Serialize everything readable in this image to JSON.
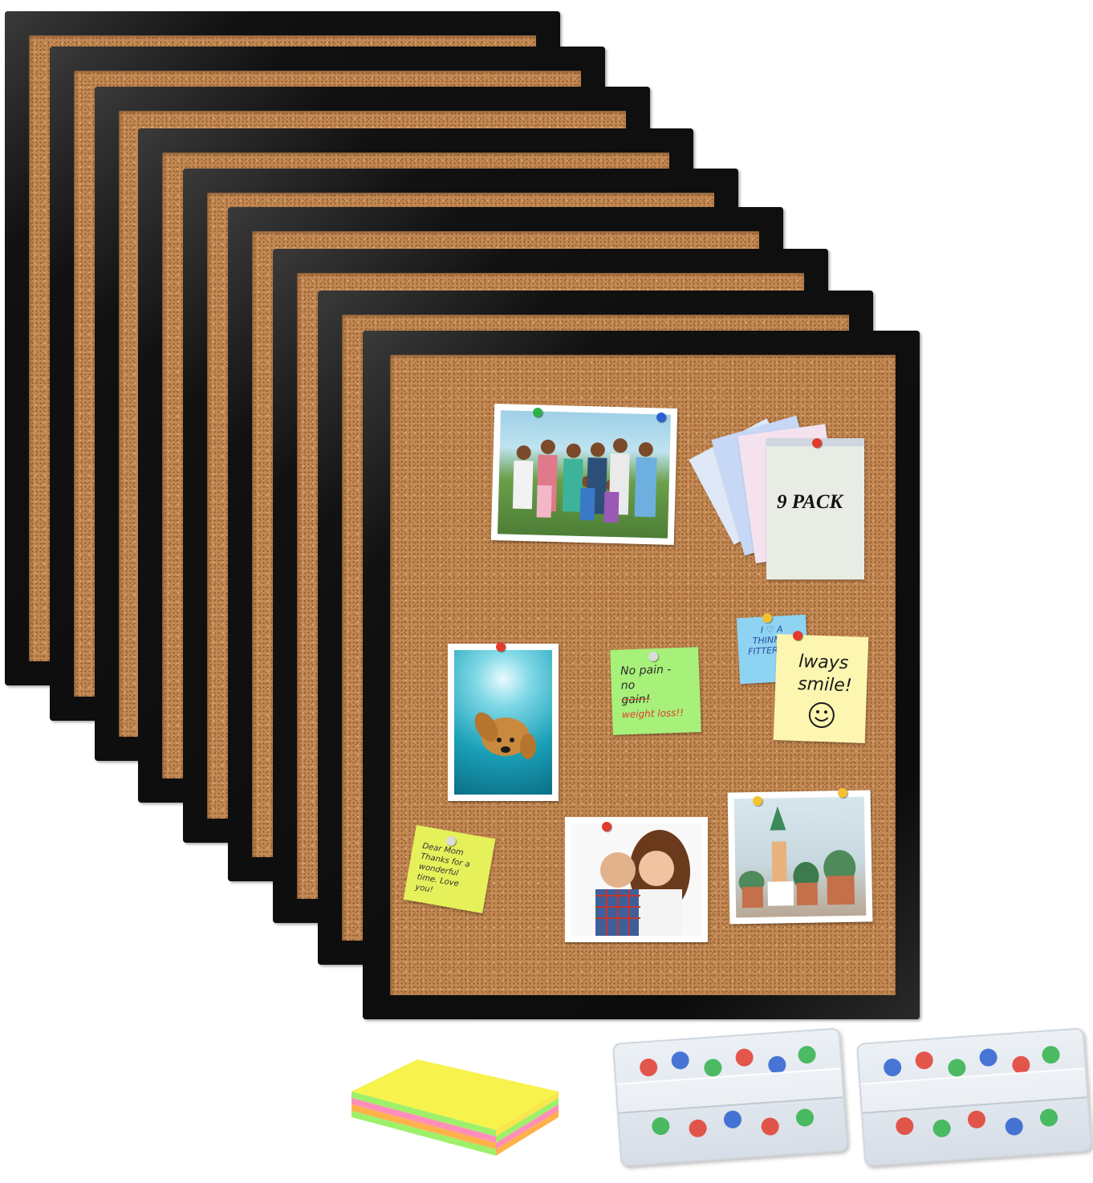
{
  "product": {
    "pack_label": "9 PACK",
    "board_count": 9
  },
  "notes": {
    "heart_note": "I ♡ A THINNER FITTER ME!",
    "smile_note": "lways smile!",
    "green_note_line1": "No pain -",
    "green_note_line2": "no",
    "green_note_line3": "gain!",
    "green_note_line4": "weight loss!!",
    "yellow_note": "Dear Mom Thanks for a wonderful time. Love you!"
  },
  "colors": {
    "frame": "#141414",
    "cork": "#c48a55",
    "note_blue": "#8fd3f3",
    "note_green": "#a7f07a",
    "note_yellow": "#fdf6b0",
    "note_lime": "#e6f05a"
  },
  "accessories": {
    "sticky_pad_colors": [
      "#f7f24c",
      "#9ef06a",
      "#ff8fb8",
      "#ffb24a"
    ],
    "pin_box_count": 2
  }
}
